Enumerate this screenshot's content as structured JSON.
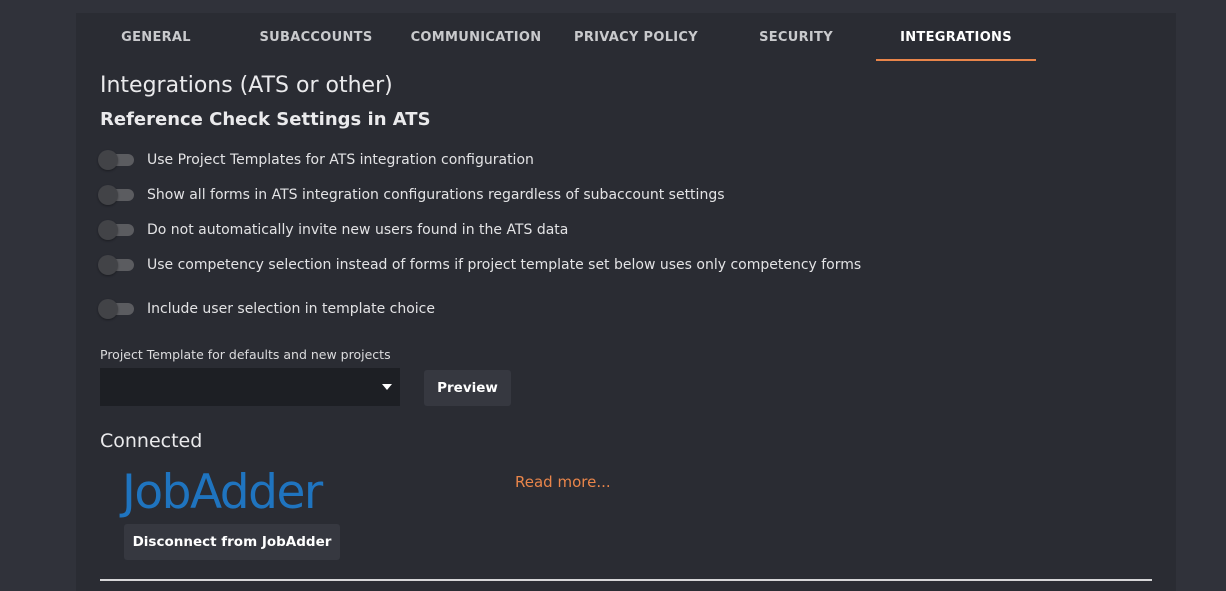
{
  "tabs": [
    {
      "label": "GENERAL"
    },
    {
      "label": "SUBACCOUNTS"
    },
    {
      "label": "COMMUNICATION"
    },
    {
      "label": "PRIVACY POLICY"
    },
    {
      "label": "SECURITY"
    },
    {
      "label": "INTEGRATIONS",
      "active": true
    }
  ],
  "page": {
    "title": "Integrations (ATS or other)",
    "section_title": "Reference Check Settings in ATS"
  },
  "toggles": [
    {
      "label": "Use Project Templates for ATS integration configuration",
      "checked": false
    },
    {
      "label": "Show all forms in ATS integration configurations regardless of subaccount settings",
      "checked": false
    },
    {
      "label": "Do not automatically invite new users found in the ATS data",
      "checked": false
    },
    {
      "label": "Use competency selection instead of forms if project template set below uses only competency forms",
      "checked": false
    },
    {
      "label": "Include user selection in template choice",
      "checked": false
    }
  ],
  "template_select": {
    "caption": "Project Template for defaults and new projects",
    "value": ""
  },
  "preview_button": "Preview",
  "connected": {
    "heading": "Connected",
    "logo_text": "JobAdder",
    "disconnect_button": "Disconnect from JobAdder",
    "read_more": "Read more..."
  },
  "colors": {
    "accent": "#e9854a",
    "jobadder_blue": "#1f74bf",
    "panel_bg": "#2a2c33",
    "page_bg": "#30323a"
  }
}
